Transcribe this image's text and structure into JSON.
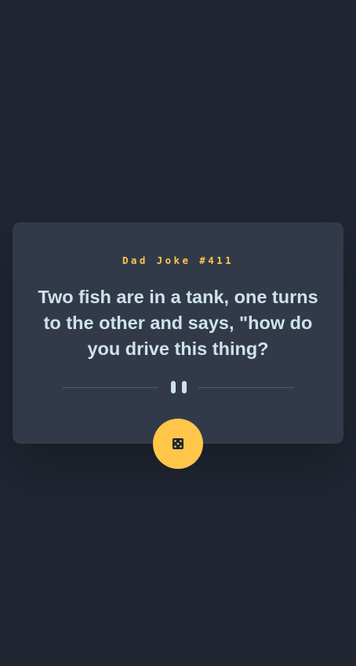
{
  "advice": {
    "label": "Dad Joke #411",
    "text": "Two fish are in a tank, one turns to the other and says, \"how do you drive this thing?"
  },
  "colors": {
    "background": "#202632",
    "card": "#323a49",
    "accent": "#ffc64a",
    "text": "#cee3e9",
    "divider": "#4f5d74"
  },
  "icons": {
    "divider": "pause-icon",
    "button": "dice-icon"
  }
}
